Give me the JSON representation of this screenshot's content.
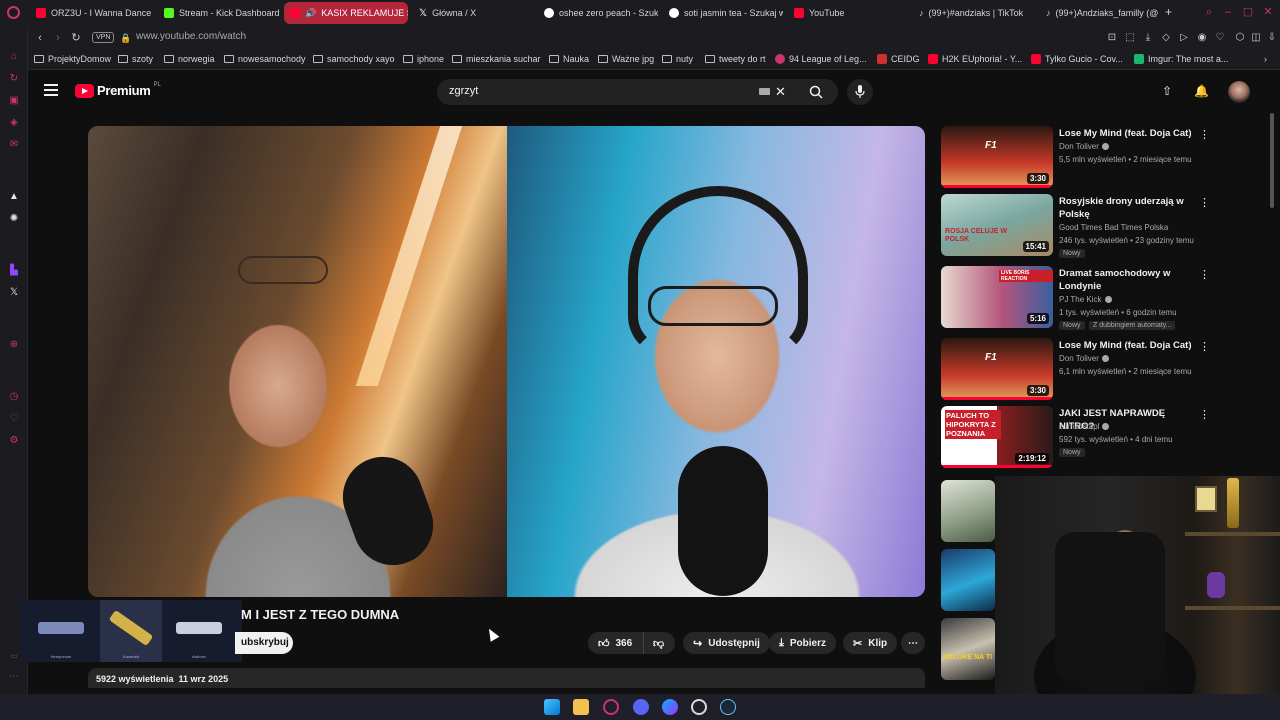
{
  "browser": {
    "tabs": [
      {
        "title": "ORZ3U - I Wanna Dance",
        "icon": "youtube-icon",
        "color": "#ff0033"
      },
      {
        "title": "Stream - Kick Dashboard",
        "icon": "kick-icon",
        "color": "#53fc18"
      },
      {
        "title": "KASIX REKLAMUJE S",
        "icon": "youtube-icon",
        "color": "#ff0033",
        "active": true
      },
      {
        "title": "Główna / X",
        "icon": "x-icon",
        "color": "#ffffff"
      },
      {
        "title": "oshee zero peach - Szuk",
        "icon": "google-icon",
        "color": "#ffffff"
      },
      {
        "title": "soti jasmin tea - Szukaj w",
        "icon": "google-icon",
        "color": "#ffffff"
      },
      {
        "title": "YouTube",
        "icon": "youtube-icon",
        "color": "#ff0033"
      },
      {
        "title": "(99+)#andziaks | TikTok",
        "icon": "tiktok-icon",
        "color": "#ffffff"
      },
      {
        "title": "(99+)Andziaks_familly (@",
        "icon": "tiktok-icon",
        "color": "#ffffff"
      }
    ],
    "new_tab": "+",
    "vpn": "VPN",
    "url": "www.youtube.com/watch",
    "bookmarks": [
      {
        "label": "ProjektyDomow",
        "type": "folder"
      },
      {
        "label": "szoty",
        "type": "folder"
      },
      {
        "label": "norwegia",
        "type": "folder"
      },
      {
        "label": "nowesamochody",
        "type": "folder"
      },
      {
        "label": "samochody xayo",
        "type": "folder"
      },
      {
        "label": "iphone",
        "type": "folder"
      },
      {
        "label": "mieszkania suchar",
        "type": "folder"
      },
      {
        "label": "Nauka",
        "type": "folder"
      },
      {
        "label": "Ważne jpg",
        "type": "folder"
      },
      {
        "label": "nuty",
        "type": "folder"
      },
      {
        "label": "tweety do rt",
        "type": "folder"
      },
      {
        "label": "94 League of Leg...",
        "type": "site"
      },
      {
        "label": "CEIDG",
        "type": "site"
      },
      {
        "label": "H2K EUphoria! - Y...",
        "type": "site"
      },
      {
        "label": "Tylko Gucio - Cov...",
        "type": "site"
      },
      {
        "label": "Imgur: The most a...",
        "type": "site"
      }
    ]
  },
  "youtube": {
    "logo_text": "Premium",
    "logo_region": "PL",
    "search_query": "zgrzyt",
    "video": {
      "title_visible": "M I JEST Z TEGO DUMNA",
      "subscribe_label": "Subskrybuj",
      "subscribe_visible": "ubskrybuj",
      "likes": "366",
      "share_label": "Udostępnij",
      "download_label": "Pobierz",
      "clip_label": "Klip",
      "views": "5922 wyświetlenia",
      "date": "11 wrz 2025"
    },
    "skins": [
      {
        "name": "Hemporium",
        "color": "#7b8ab8"
      },
      {
        "name": "Karambit",
        "color": "#d4b24a"
      },
      {
        "name": "Asiimov",
        "color": "#c8cfe0"
      }
    ],
    "recommendations": [
      {
        "title": "Lose My Mind (feat. Doja Cat)",
        "channel": "Don Toliver",
        "verified": true,
        "stats": "5,5 mln wyświetleń • 2 miesiące temu",
        "duration": "3:30",
        "badges": [],
        "thumb": "#c83a2a",
        "progress": 1.0
      },
      {
        "title": "Rosyjskie drony uderzają w Polskę",
        "channel": "Good Times Bad Times Polska",
        "verified": false,
        "stats": "246 tys. wyświetleń • 23 godziny temu",
        "duration": "15:41",
        "badges": [
          "Nowy"
        ],
        "thumb": "#7aa6a0",
        "progress": 0
      },
      {
        "title": "Dramat samochodowy w Londynie",
        "channel": "PJ The Kick",
        "verified": true,
        "stats": "1 tys. wyświetleń • 6 godzin temu",
        "duration": "5:16",
        "badges": [
          "Nowy",
          "Z dubbingiem automaty..."
        ],
        "thumb": "#b3547a",
        "progress": 0
      },
      {
        "title": "Lose My Mind (feat. Doja Cat)",
        "channel": "Don Toliver",
        "verified": true,
        "stats": "6,1 mln wyświetleń • 2 miesiące temu",
        "duration": "3:30",
        "badges": [],
        "thumb": "#c83a2a",
        "progress": 1.0
      },
      {
        "title": "JAKI JEST NAPRAWDĘ NITRO?",
        "channel": "zurnalistapl",
        "verified": true,
        "stats": "592 tys. wyświetleń • 4 dni temu",
        "duration": "2:19:12",
        "badges": [
          "Nowy"
        ],
        "thumb": "#8a1e1e",
        "progress": 1.0
      }
    ],
    "thumb_texts": {
      "rosja": "ROSJA CELUJE W POLSK",
      "nitro": "PALUCH TO HIPOKRYTA Z POZNANIA",
      "live": "LIVE BORIS REACTION",
      "bottom": "DELORE NA TI"
    }
  },
  "colors": {
    "accent": "#ff0033",
    "tab_active": "#b3263a",
    "opera": "#c9356c"
  }
}
